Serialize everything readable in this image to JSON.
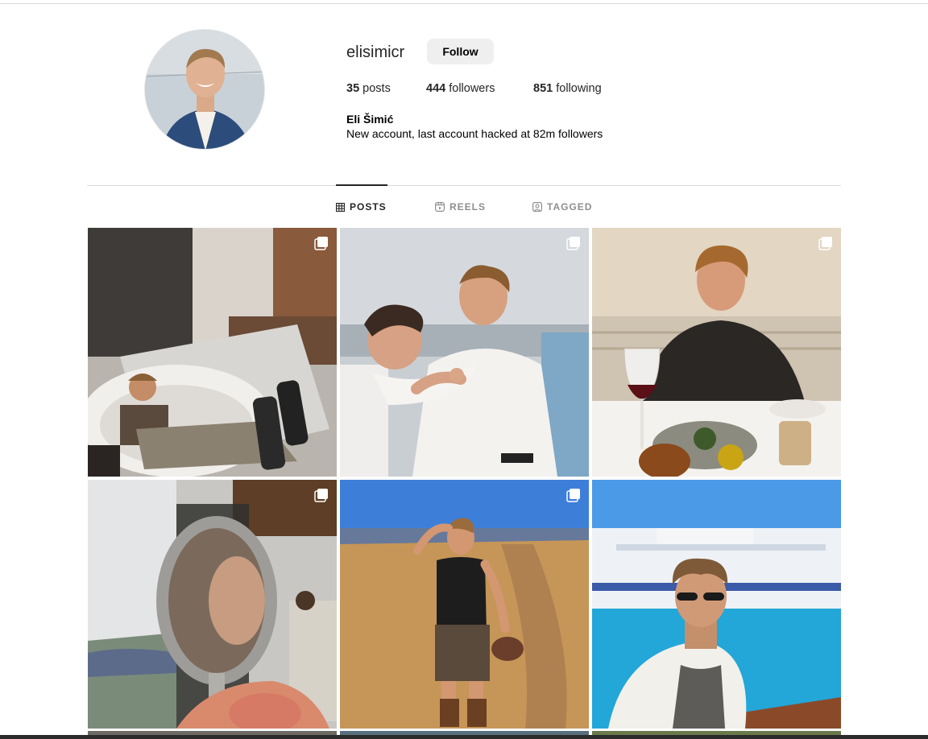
{
  "profile": {
    "username": "elisimicr",
    "follow_label": "Follow",
    "posts_count": "35",
    "posts_label": "posts",
    "followers_count": "444",
    "followers_label": "followers",
    "following_count": "851",
    "following_label": "following",
    "full_name": "Eli Šimić",
    "bio": "New account, last account hacked at 82m followers"
  },
  "tabs": [
    {
      "label": "POSTS",
      "icon": "grid-icon",
      "active": true
    },
    {
      "label": "REELS",
      "icon": "reels-icon",
      "active": false
    },
    {
      "label": "TAGGED",
      "icon": "tagged-icon",
      "active": false
    }
  ],
  "posts": [
    {
      "scene": "bathroom-bathtub",
      "multi": true
    },
    {
      "scene": "friends-boat-party",
      "multi": true
    },
    {
      "scene": "restaurant-dinner",
      "multi": true
    },
    {
      "scene": "spoon-reflection",
      "multi": true
    },
    {
      "scene": "field-cowboy-hat",
      "multi": true
    },
    {
      "scene": "harbor-ferry",
      "multi": false
    }
  ],
  "colors": {
    "text": "#262626",
    "muted": "#8e8e8e",
    "divider": "#dbdbdb",
    "button_bg": "#efefef"
  }
}
